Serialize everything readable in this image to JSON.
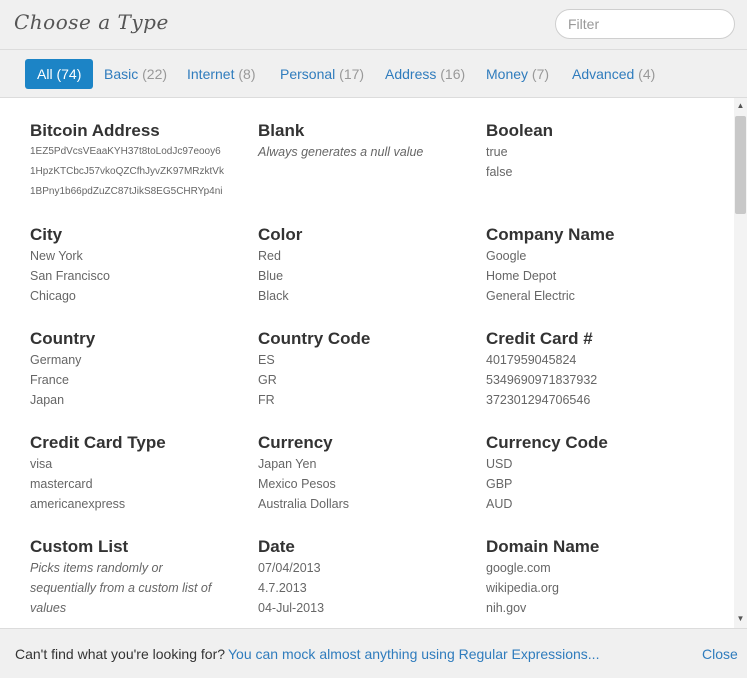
{
  "header": {
    "title": "Choose a Type",
    "filter_placeholder": "Filter"
  },
  "tabs": [
    {
      "label": "All",
      "count": "(74)",
      "active": true
    },
    {
      "label": "Basic",
      "count": "(22)"
    },
    {
      "label": "Internet",
      "count": "(8)"
    },
    {
      "label": "Personal",
      "count": "(17)"
    },
    {
      "label": "Address",
      "count": "(16)"
    },
    {
      "label": "Money",
      "count": "(7)"
    },
    {
      "label": "Advanced",
      "count": "(4)"
    }
  ],
  "types": [
    {
      "name": "Bitcoin Address",
      "examples": [
        "1EZ5PdVcsVEaaKYH37t8toLodJc97eooy6",
        "1HpzKTCbcJ57vkoQZCfhJyvZK97MRzktVk",
        "1BPny1b66pdZuZC87tJikS8EG5CHRYp4ni"
      ]
    },
    {
      "name": "Blank",
      "description": "Always generates a null value"
    },
    {
      "name": "Boolean",
      "examples": [
        "true",
        "false"
      ]
    },
    {
      "name": "City",
      "examples": [
        "New York",
        "San Francisco",
        "Chicago"
      ]
    },
    {
      "name": "Color",
      "examples": [
        "Red",
        "Blue",
        "Black"
      ]
    },
    {
      "name": "Company Name",
      "examples": [
        "Google",
        "Home Depot",
        "General Electric"
      ]
    },
    {
      "name": "Country",
      "examples": [
        "Germany",
        "France",
        "Japan"
      ]
    },
    {
      "name": "Country Code",
      "examples": [
        "ES",
        "GR",
        "FR"
      ]
    },
    {
      "name": "Credit Card #",
      "examples": [
        "4017959045824",
        "5349690971837932",
        "372301294706546"
      ]
    },
    {
      "name": "Credit Card Type",
      "examples": [
        "visa",
        "mastercard",
        "americanexpress"
      ]
    },
    {
      "name": "Currency",
      "examples": [
        "Japan Yen",
        "Mexico Pesos",
        "Australia Dollars"
      ]
    },
    {
      "name": "Currency Code",
      "examples": [
        "USD",
        "GBP",
        "AUD"
      ]
    },
    {
      "name": "Custom List",
      "description_lines": [
        "Picks items randomly or",
        "sequentially from a custom list of",
        "values"
      ]
    },
    {
      "name": "Date",
      "examples": [
        "07/04/2013",
        "4.7.2013",
        "04-Jul-2013"
      ]
    },
    {
      "name": "Domain Name",
      "examples": [
        "google.com",
        "wikipedia.org",
        "nih.gov"
      ]
    }
  ],
  "footer": {
    "text": "Can't find what you're looking for?",
    "link": "You can mock almost anything using Regular Expressions...",
    "close": "Close"
  }
}
